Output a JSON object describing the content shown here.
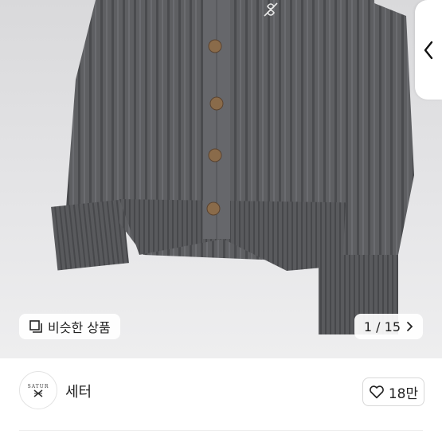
{
  "gallery": {
    "similar_label": "비슷한 상품",
    "counter_label": "1 / 15",
    "current_index": 1,
    "total_images": 15
  },
  "product": {
    "title": "세터",
    "avatar_text": "SATUR",
    "like_count_label": "18만"
  },
  "colors": {
    "sweater": "#5f6063",
    "button": "#8a6b4a",
    "background": "#e3e3e5"
  }
}
